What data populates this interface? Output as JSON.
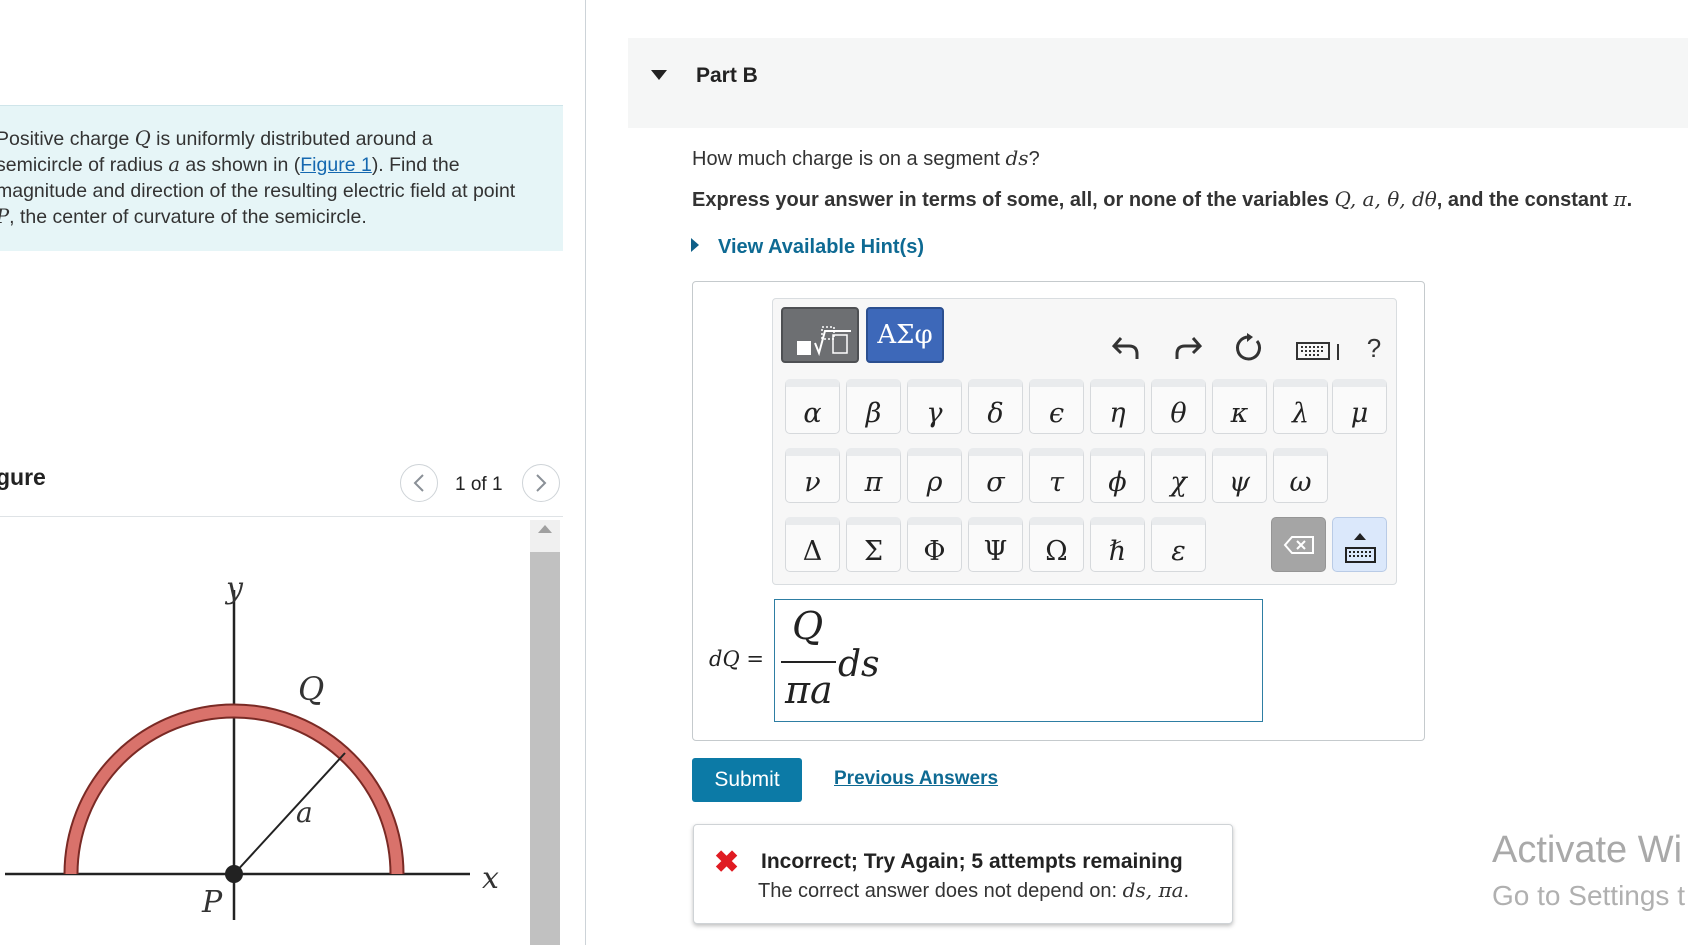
{
  "problem": {
    "text_before_Q": "Positive charge ",
    "var_Q": "Q",
    "text_after_Q": " is uniformly distributed around a semicircle of radius ",
    "var_a": "a",
    "text_before_link": " as shown in (",
    "figure_link": "Figure 1",
    "text_after_link": "). Find the magnitude and direction of the resulting electric field at point ",
    "var_P": "P",
    "text_end": ", the center of curvature of the semicircle."
  },
  "figure": {
    "label": "gure",
    "counter": "1 of 1",
    "prev_icon": "chevron-left-icon",
    "next_icon": "chevron-right-icon",
    "labels": {
      "y": "y",
      "x": "x",
      "Q": "Q",
      "a": "a",
      "P": "P"
    },
    "arc_color": "#d9726b"
  },
  "part": {
    "title": "Part B",
    "question_before": "How much charge is on a segment ",
    "question_var": "ds",
    "question_after": "?",
    "instructions_before": "Express your answer in terms of some, all, or none of the variables ",
    "instructions_vars": "Q, a, θ, dθ",
    "instructions_middle": ", and the constant ",
    "instructions_const": "π",
    "instructions_end": ".",
    "hint_link": "View Available Hint(s)"
  },
  "toolbar": {
    "greek_tab": "ΑΣφ",
    "row1": [
      "α",
      "β",
      "γ",
      "δ",
      "ϵ",
      "η",
      "θ",
      "κ",
      "λ",
      "μ"
    ],
    "row2": [
      "ν",
      "π",
      "ρ",
      "σ",
      "τ",
      "ϕ",
      "χ",
      "ψ",
      "ω"
    ],
    "row3": [
      "Δ",
      "Σ",
      "Φ",
      "Ψ",
      "Ω",
      "ℏ",
      "ε"
    ],
    "help": "?"
  },
  "answer": {
    "label": "dQ =",
    "numerator": "Q",
    "denominator": "πa",
    "after_fraction": "ds"
  },
  "actions": {
    "submit": "Submit",
    "previous_answers": "Previous Answers"
  },
  "feedback": {
    "title": "Incorrect; Try Again; 5 attempts remaining",
    "detail_before": "The correct answer does not depend on: ",
    "detail_vars": "ds, πa",
    "detail_end": "."
  },
  "watermark": {
    "line1": "Activate Wi",
    "line2": "Go to Settings t"
  },
  "colors": {
    "accent": "#0c7aa6",
    "greek_tab": "#3d68b9",
    "error": "#e01b22",
    "problem_bg": "#e6f5f7"
  }
}
